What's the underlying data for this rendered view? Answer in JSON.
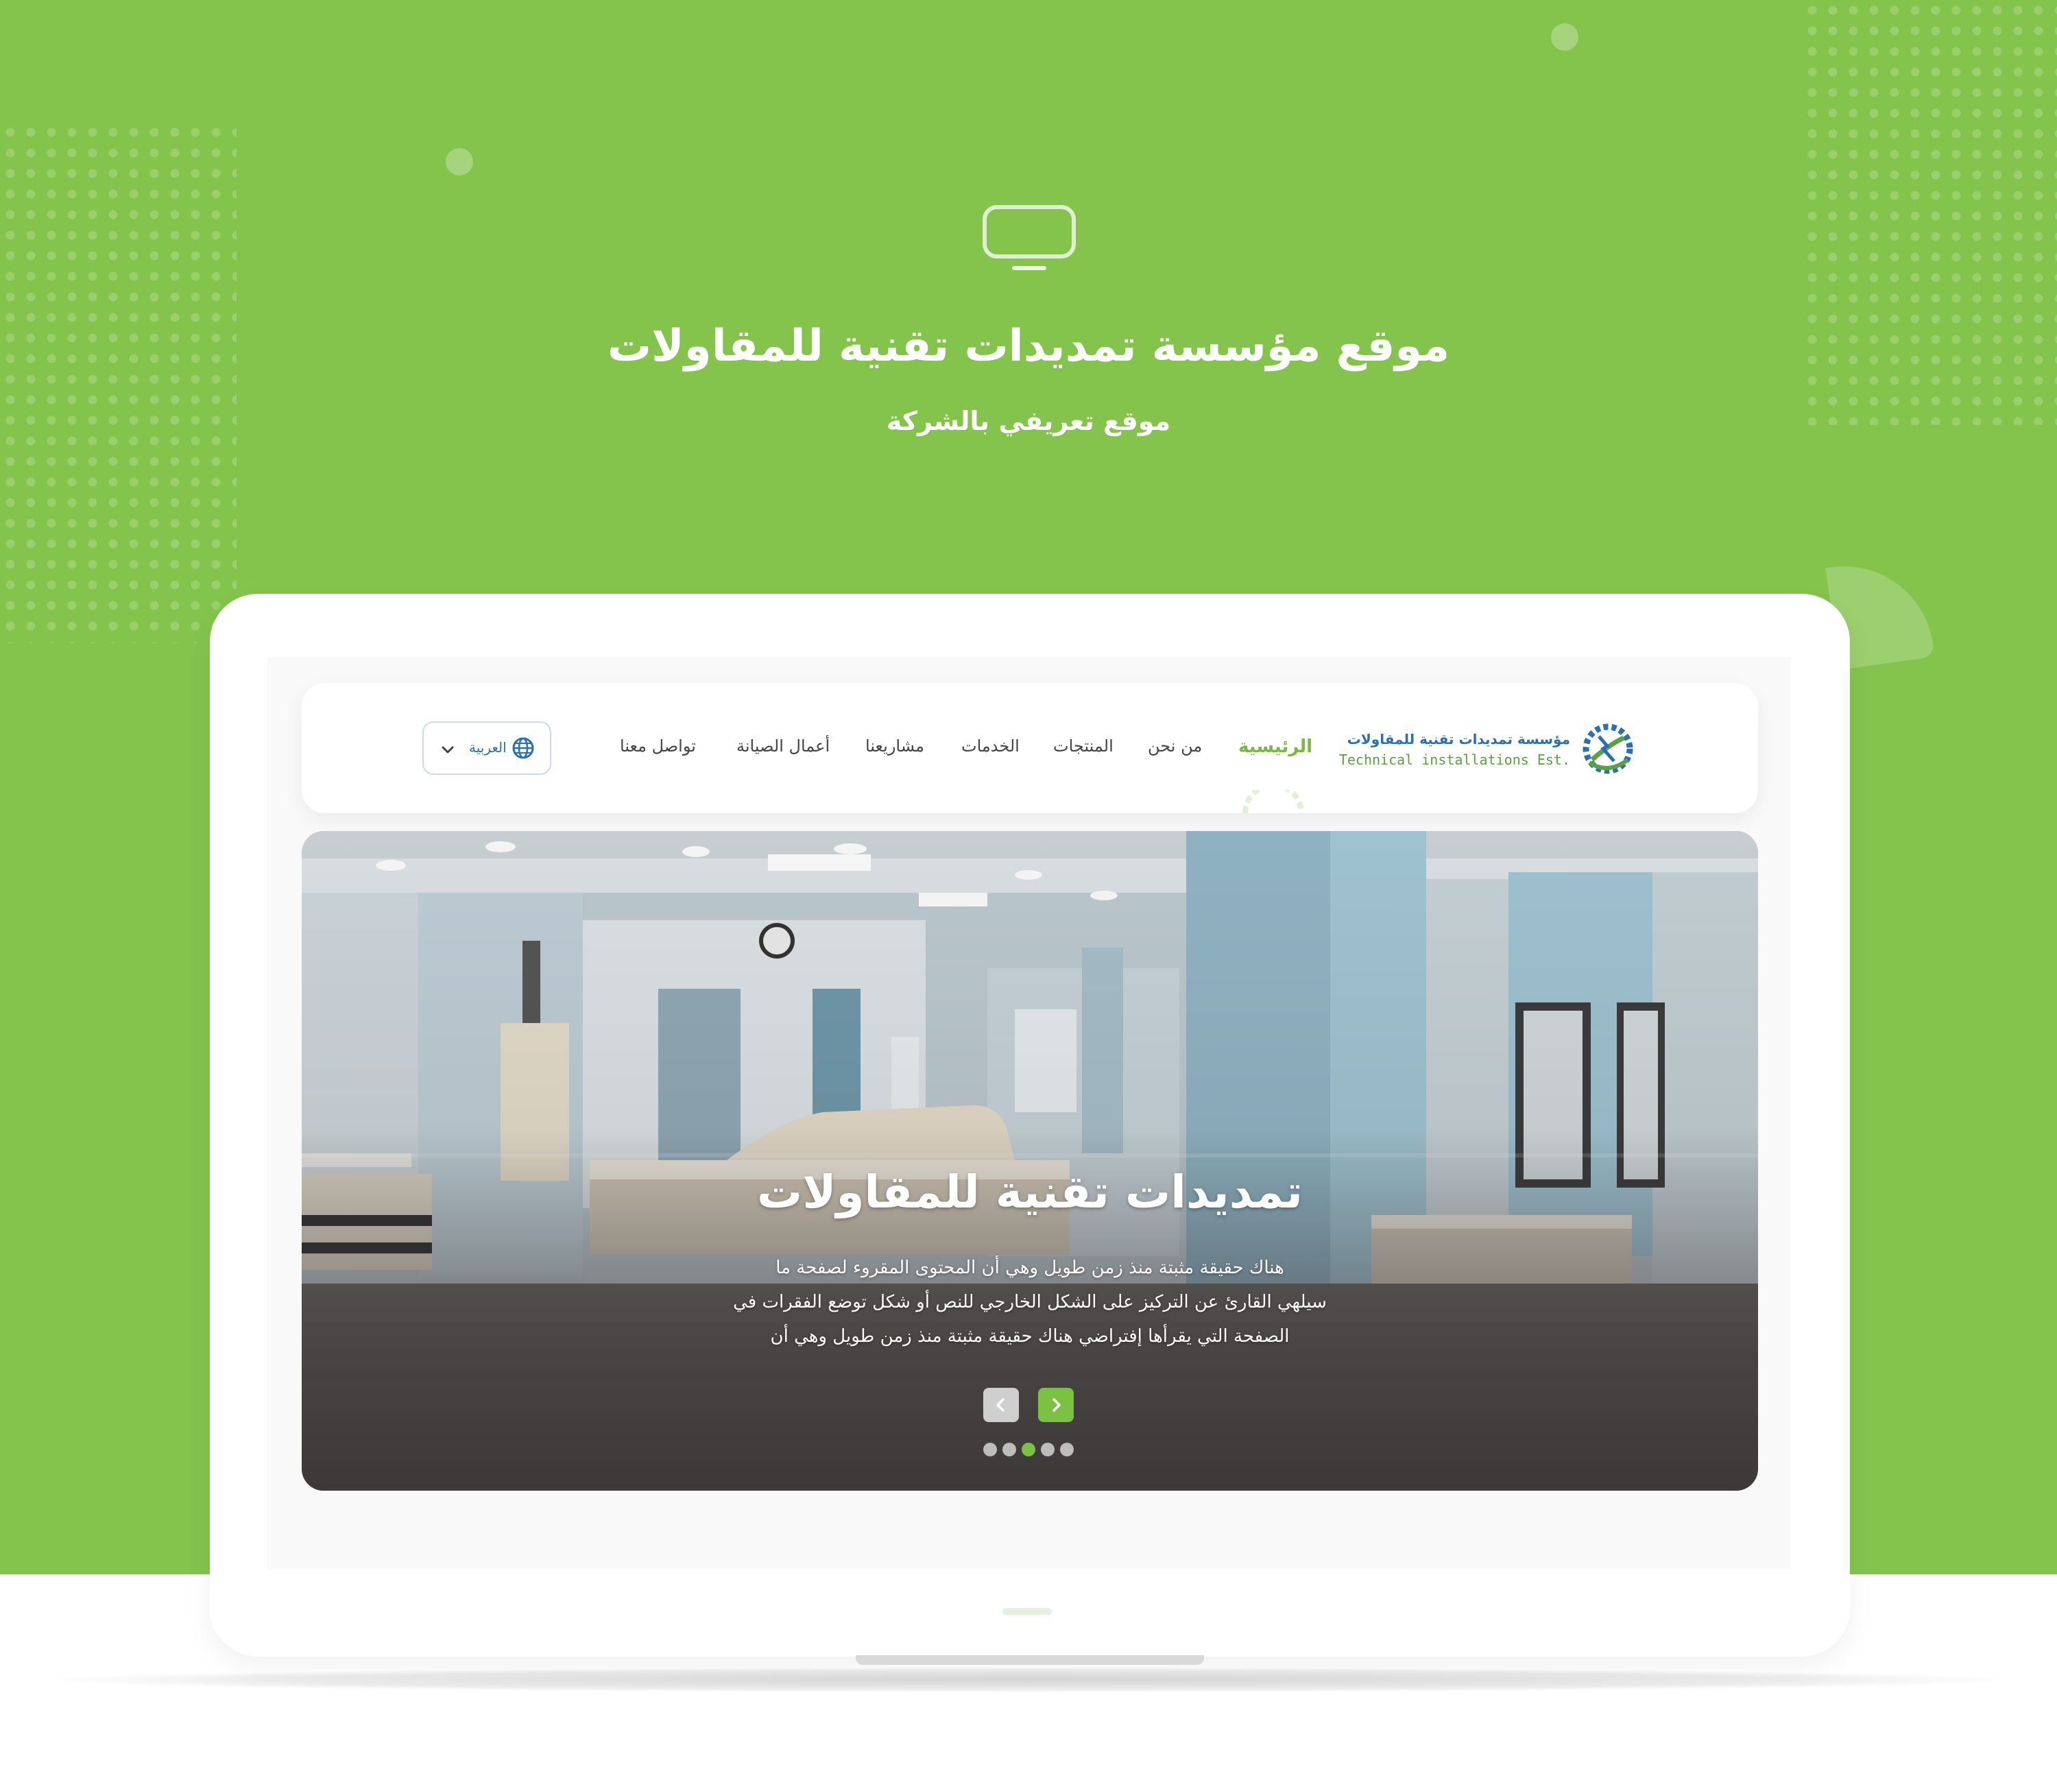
{
  "page": {
    "title": "موقع مؤسسة تمديدات تقنية للمقاولات",
    "subtitle": "موقع تعريفي بالشركة",
    "icon": "monitor-icon",
    "colors": {
      "background": "#84c44c",
      "accent": "#7cc242",
      "brand_blue": "#2a6fb6"
    }
  },
  "site": {
    "logo": {
      "name_ar": "مؤسسة تمديدات تقنية للمقاولات",
      "name_en": "Technical installations Est."
    },
    "nav": {
      "items": [
        {
          "label": "الرئيسية",
          "active": true
        },
        {
          "label": "من نحن",
          "active": false
        },
        {
          "label": "المنتجات",
          "active": false
        },
        {
          "label": "الخدمات",
          "active": false
        },
        {
          "label": "مشاريعنا",
          "active": false
        },
        {
          "label": "أعمال الصيانة",
          "active": false
        },
        {
          "label": "تواصل معنا",
          "active": false
        }
      ]
    },
    "language": {
      "label": "العربية",
      "icon": "globe-icon"
    },
    "slider": {
      "title": "تمديدات تقنية للمقاولات",
      "text_lines": [
        "هناك حقيقة مثبتة منذ زمن طويل وهي أن المحتوى المقروء لصفحة ما",
        "سيلهي القارئ عن التركيز على الشكل الخارجي للنص أو شكل توضع الفقرات في",
        "الصفحة التي يقرأها إفتراضي هناك حقيقة مثبتة منذ زمن طويل وهي أن"
      ],
      "slide_count": 5,
      "active_slide": 3
    }
  }
}
